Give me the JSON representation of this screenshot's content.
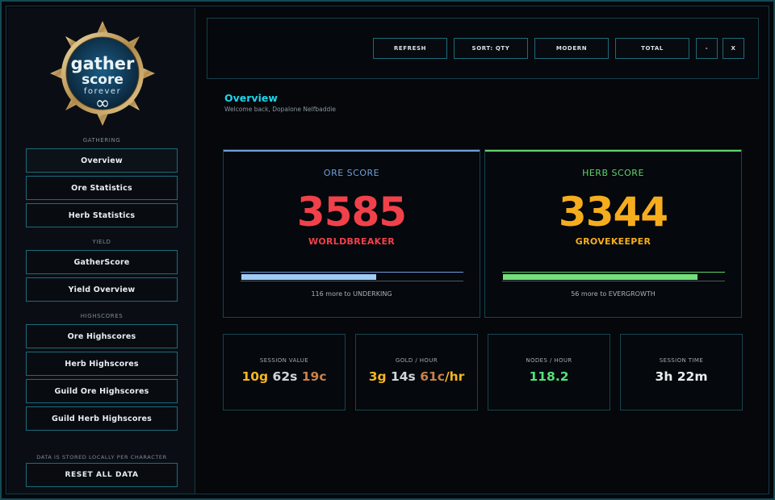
{
  "app": {
    "logo": {
      "line1": "gather",
      "line2": "score",
      "line3": "forever",
      "glyph": "∞"
    }
  },
  "sidebar": {
    "sections": {
      "gathering": "GATHERING",
      "yield": "YIELD",
      "highscores": "HIGHSCORES"
    },
    "items": {
      "overview": "Overview",
      "ore_statistics": "Ore Statistics",
      "herb_statistics": "Herb Statistics",
      "gatherscore": "GatherScore",
      "yield_overview": "Yield Overview",
      "ore_highscores": "Ore Highscores",
      "herb_highscores": "Herb Highscores",
      "guild_ore_highscores": "Guild Ore Highscores",
      "guild_herb_highscores": "Guild Herb Highscores"
    },
    "storage_note": "DATA IS STORED LOCALLY PER CHARACTER",
    "reset_label": "RESET ALL DATA"
  },
  "toolbar": {
    "refresh": "REFRESH",
    "sort": "SORT: QTY",
    "mode": "MODERN",
    "total": "TOTAL",
    "minimize": "-",
    "close": "X"
  },
  "page": {
    "title": "Overview",
    "subtitle": "Welcome back, Dopalone Nelfbaddie"
  },
  "scores": {
    "ore": {
      "label": "ORE SCORE",
      "value": "3585",
      "rank": "WORLDBREAKER",
      "progress": 0.61,
      "to_next": "116 more to UNDERKING",
      "accent": "#6f9fdc",
      "value_color": "#f0414a",
      "bar_color": "#9fcbf5"
    },
    "herb": {
      "label": "HERB SCORE",
      "value": "3344",
      "rank": "GROVEKEEPER",
      "progress": 0.88,
      "to_next": "56 more to EVERGROWTH",
      "accent": "#5fd36a",
      "value_color": "#f6ad1d",
      "bar_color": "#74e07c"
    }
  },
  "stats": {
    "session_value": {
      "label": "SESSION VALUE",
      "gold": "10g",
      "silver": "62s",
      "copper": "19c"
    },
    "gold_per_hour": {
      "label": "GOLD / HOUR",
      "gold": "3g",
      "silver": "14s",
      "copper": "61c",
      "suffix": "/hr"
    },
    "nodes_per_hour": {
      "label": "NODES / HOUR",
      "value": "118.2",
      "color": "#53e17a"
    },
    "session_time": {
      "label": "SESSION TIME",
      "value": "3h 22m"
    }
  }
}
